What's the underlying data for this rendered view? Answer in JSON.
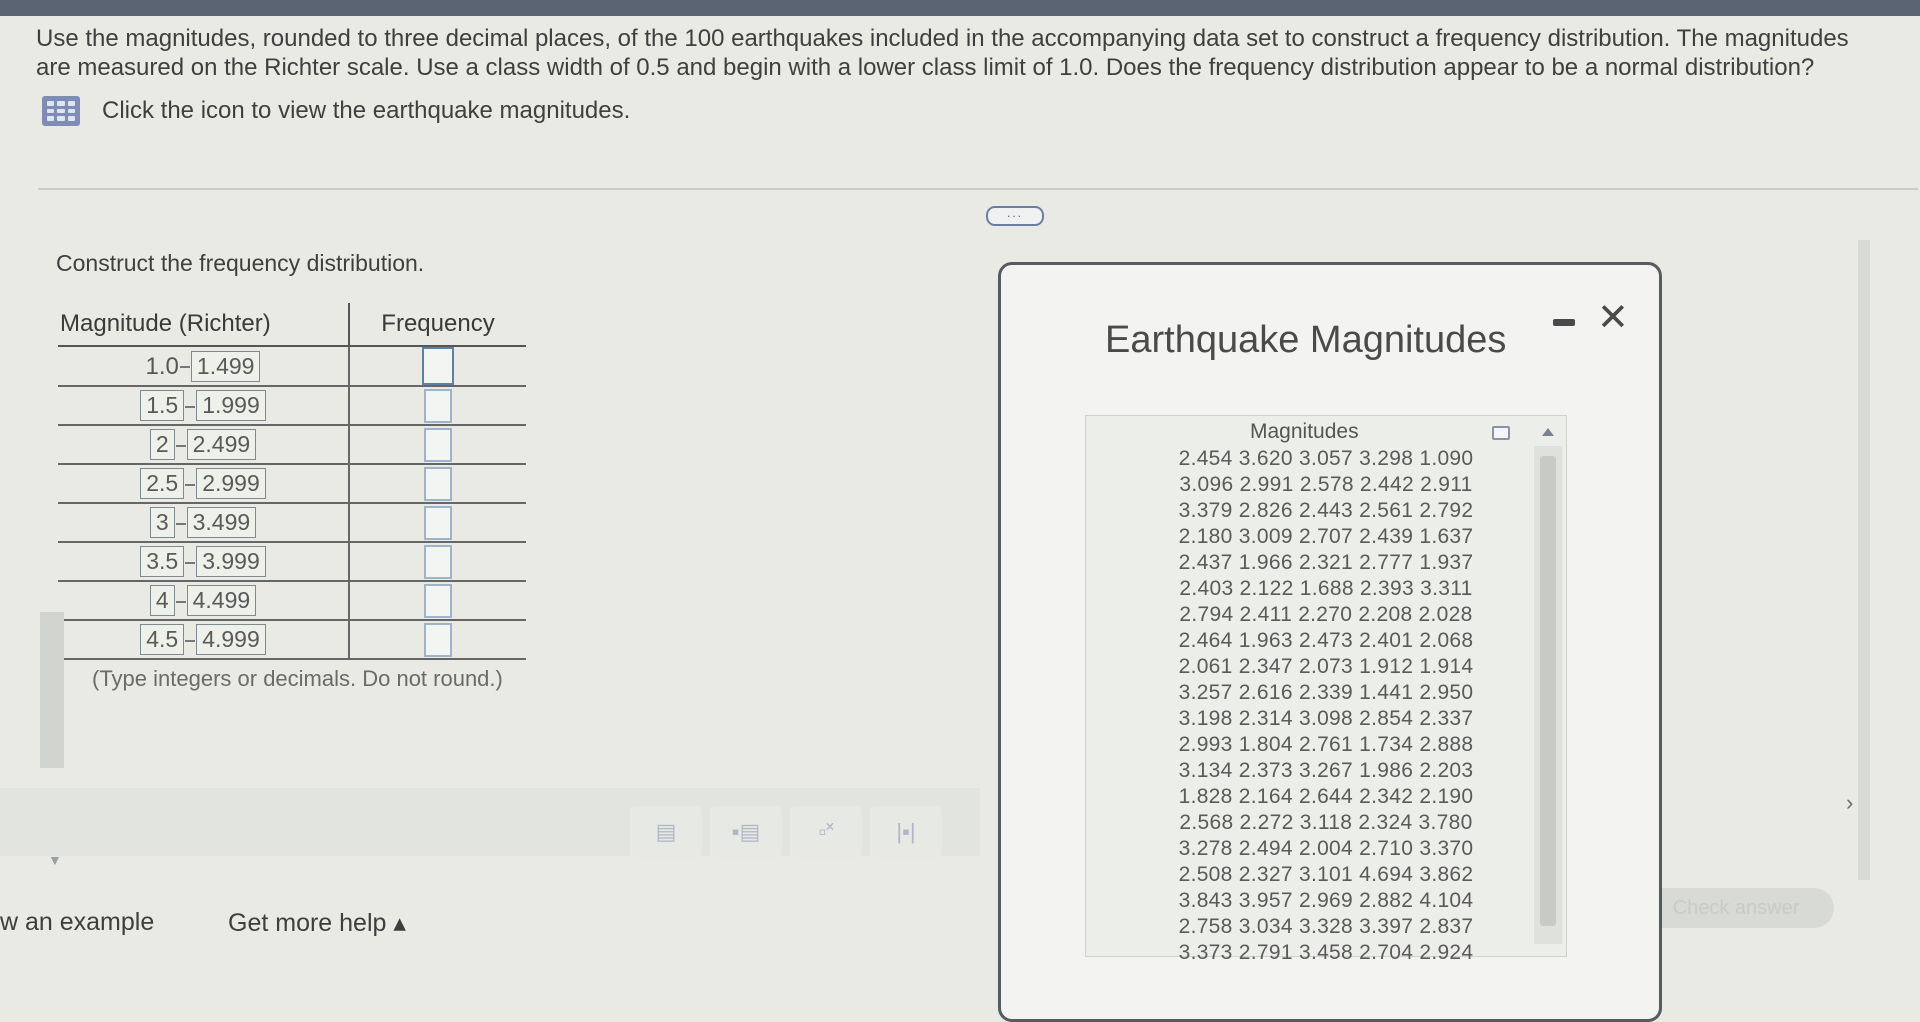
{
  "question": {
    "text": "Use the magnitudes, rounded to three decimal places, of the 100 earthquakes included in the accompanying data set to construct a frequency distribution. The magnitudes are measured on the Richter scale. Use a class width of 0.5 and begin with a lower class limit of 1.0. Does the frequency distribution appear to be a normal distribution?",
    "icon_link": "Click the icon to view the earthquake magnitudes."
  },
  "more_button": "...",
  "construct_label": "Construct the frequency distribution.",
  "table": {
    "headers": [
      "Magnitude (Richter)",
      "Frequency"
    ],
    "rows": [
      {
        "lower": "1.0",
        "upper": "1.499"
      },
      {
        "lower": "1.5",
        "upper": "1.999"
      },
      {
        "lower": "2",
        "upper": "2.499"
      },
      {
        "lower": "2.5",
        "upper": "2.999"
      },
      {
        "lower": "3",
        "upper": "3.499"
      },
      {
        "lower": "3.5",
        "upper": "3.999"
      },
      {
        "lower": "4",
        "upper": "4.499"
      },
      {
        "lower": "4.5",
        "upper": "4.999"
      }
    ]
  },
  "note": "(Type integers or decimals. Do not round.)",
  "bottom_links": {
    "example": "w an example",
    "help": "Get more help ▴"
  },
  "check_answer": "Check answer",
  "panel": {
    "title": "Earthquake Magnitudes",
    "column_header": "Magnitudes",
    "rows": [
      "2.454  3.620  3.057  3.298  1.090",
      "3.096  2.991  2.578  2.442  2.911",
      "3.379  2.826  2.443  2.561  2.792",
      "2.180  3.009  2.707  2.439  1.637",
      "2.437  1.966  2.321  2.777  1.937",
      "2.403  2.122  1.688  2.393  3.311",
      "2.794  2.411  2.270  2.208  2.028",
      "2.464  1.963  2.473  2.401  2.068",
      "2.061  2.347  2.073  1.912  1.914",
      "3.257  2.616  2.339  1.441  2.950",
      "3.198  2.314  3.098  2.854  2.337",
      "2.993  1.804  2.761  1.734  2.888",
      "3.134  2.373  3.267  1.986  2.203",
      "1.828  2.164  2.644  2.342  2.190",
      "2.568  2.272  3.118  2.324  3.780",
      "3.278  2.494  2.004  2.710  3.370",
      "2.508  2.327  3.101  4.694  3.862",
      "3.843  3.957  2.969  2.882  4.104",
      "2.758  3.034  3.328  3.397  2.837",
      "3.373  2.791  3.458  2.704  2.924"
    ]
  }
}
